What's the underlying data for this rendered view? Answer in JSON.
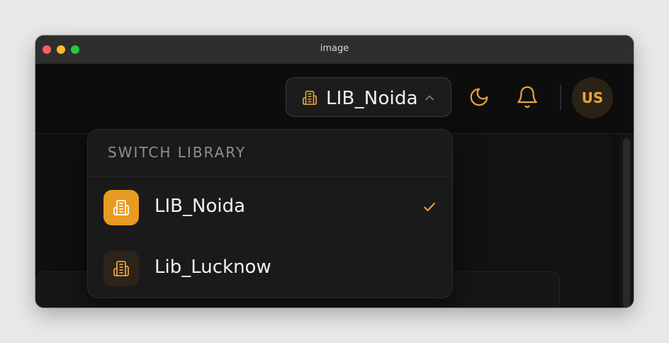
{
  "window": {
    "title": "image"
  },
  "header": {
    "library_selector": {
      "selected_label": "LIB_Noida"
    },
    "avatar": {
      "initials": "US"
    }
  },
  "dropdown": {
    "heading": "SWITCH LIBRARY",
    "items": [
      {
        "label": "LIB_Noida",
        "selected": true,
        "icon": "building-icon"
      },
      {
        "label": "Lib_Lucknow",
        "selected": false,
        "icon": "building-icon"
      }
    ]
  },
  "colors": {
    "accent": "#e99a20",
    "background": "#0e0e0e",
    "panel": "#1a1a1a",
    "text": "#f2f2f2",
    "muted_text": "#8f8f8f"
  }
}
